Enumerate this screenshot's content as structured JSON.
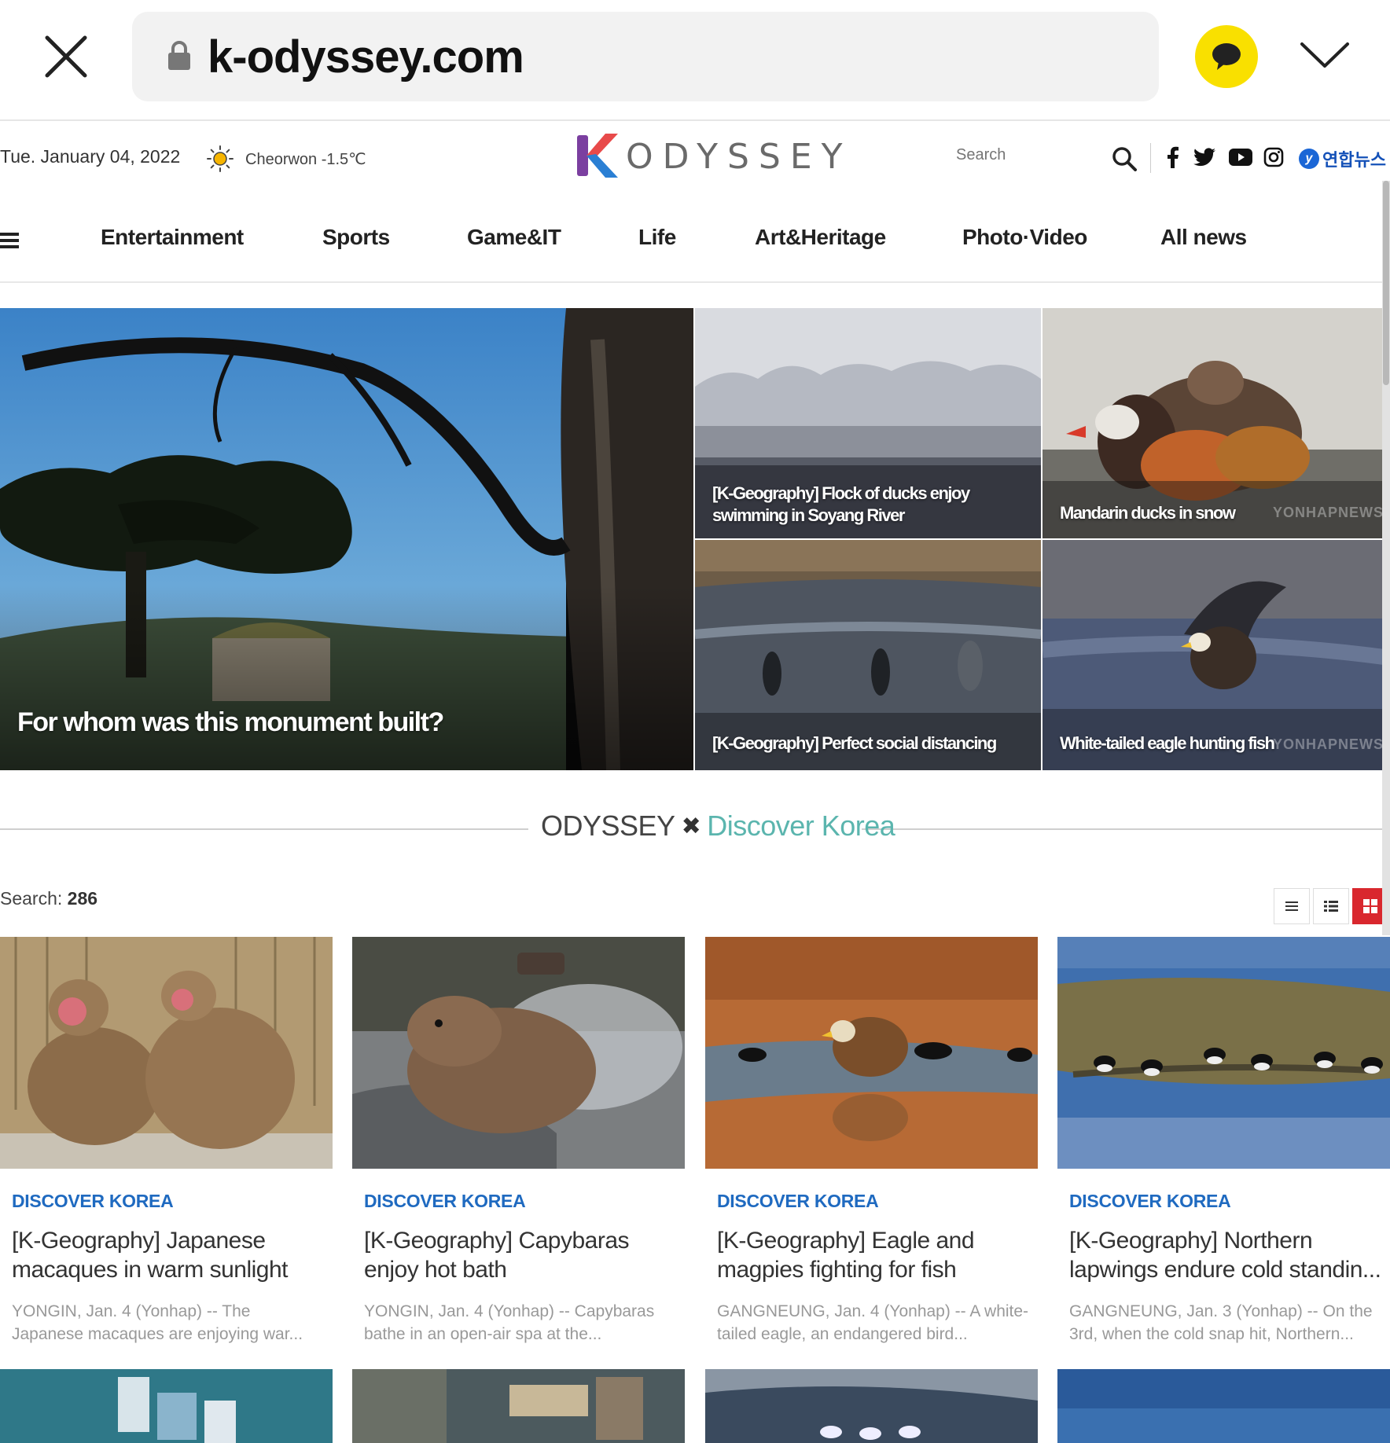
{
  "browser": {
    "url": "k-odyssey.com",
    "accent_kakao": "#f9e000"
  },
  "header": {
    "date": "Tue. January 04, 2022",
    "weather": "Cheorwon -1.5℃",
    "logo_text": "ODYSSEY",
    "search_placeholder": "Search",
    "partner": "연합뉴스"
  },
  "nav": {
    "items": [
      "Entertainment",
      "Sports",
      "Game&IT",
      "Life",
      "Art&Heritage",
      "Photo·Video",
      "All news"
    ]
  },
  "hero": {
    "main_caption": "For whom was this monument built?",
    "tiles": [
      {
        "caption": "[K-Geography] Flock of ducks enjoy swimming in Soyang River"
      },
      {
        "caption": "Mandarin ducks in snow",
        "watermark": "YONHAPNEWS"
      },
      {
        "caption": "[K-Geography] Perfect social distancing"
      },
      {
        "caption": "White-tailed eagle hunting fish",
        "watermark": "YONHAPNEWS"
      }
    ]
  },
  "section": {
    "left": "ODYSSEY",
    "right": "Discover Korea",
    "accent": "#5bb5ae"
  },
  "results": {
    "label": "Search:",
    "count": "286"
  },
  "cards": [
    {
      "category": "DISCOVER KOREA",
      "title": "[K-Geography] Japanese macaques in warm sunlight",
      "desc": "YONGIN, Jan. 4 (Yonhap) -- The Japanese macaques are enjoying war..."
    },
    {
      "category": "DISCOVER KOREA",
      "title": "[K-Geography] Capybaras enjoy hot bath",
      "desc": "YONGIN, Jan. 4 (Yonhap) -- Capybaras bathe in an open-air spa at the..."
    },
    {
      "category": "DISCOVER KOREA",
      "title": "[K-Geography] Eagle and magpies fighting for fish",
      "desc": "GANGNEUNG, Jan. 4 (Yonhap) -- A white-tailed eagle, an endangered bird..."
    },
    {
      "category": "DISCOVER KOREA",
      "title": "[K-Geography] Northern lapwings endure cold standin...",
      "desc": "GANGNEUNG, Jan. 3 (Yonhap) -- On the 3rd, when the cold snap hit, Northern..."
    }
  ],
  "icons": {
    "close": "close-icon",
    "lock": "lock-icon",
    "kakao": "chat-bubble-icon",
    "chevron": "chevron-down-icon",
    "weather": "sun-icon",
    "search": "search-icon",
    "socials": [
      "facebook-icon",
      "twitter-icon",
      "youtube-icon",
      "instagram-icon"
    ]
  }
}
